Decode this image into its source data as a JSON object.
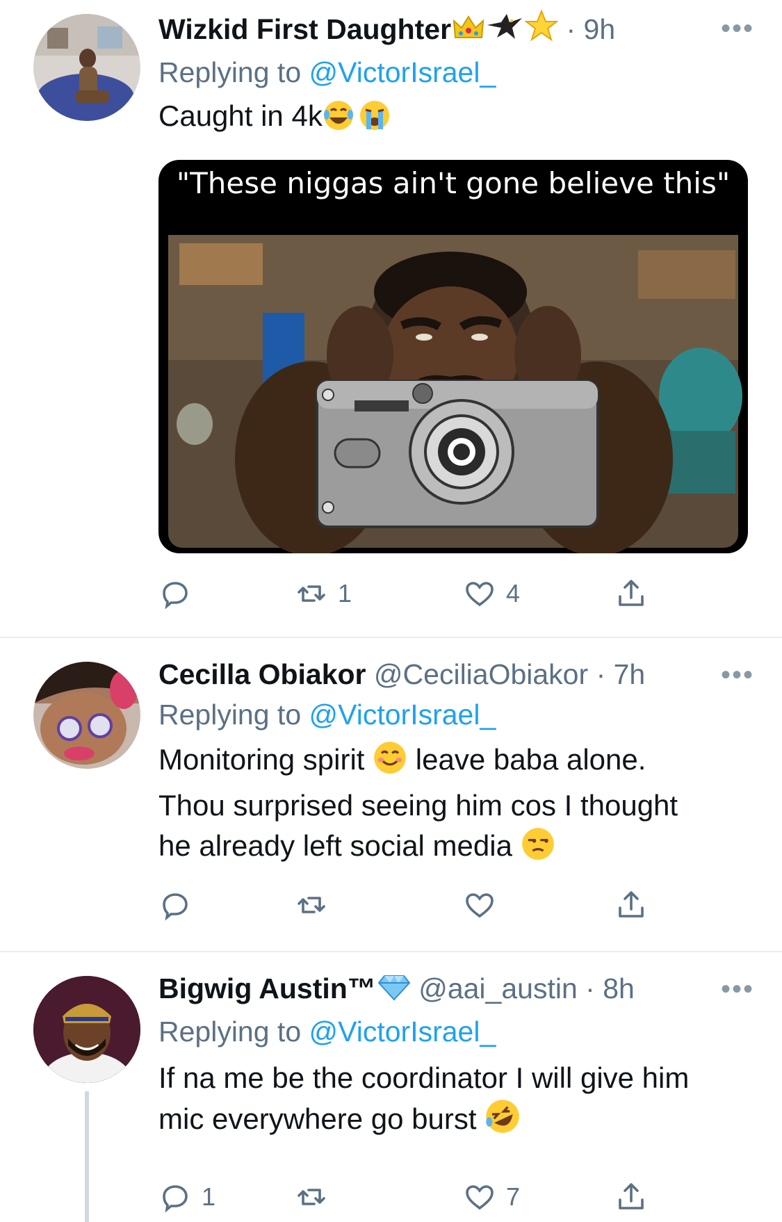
{
  "tweets": [
    {
      "name": "Wizkid First Daughter",
      "handle": "",
      "time": "· 9h",
      "badges": [
        "crown-emoji",
        "eagle-emoji",
        "star-emoji"
      ],
      "replying_label": "Replying to",
      "replying_to": "@VictorIsrael_",
      "text": "Caught in 4k",
      "emojis": [
        "laughing-crying-emoji",
        "loudly-crying-emoji"
      ],
      "media_caption": "\"These niggas ain't gone believe this\"",
      "reply_count": "",
      "retweet_count": "1",
      "like_count": "4"
    },
    {
      "name": "Cecilla Obiakor",
      "handle": "@CeciliaObiakor",
      "time": "· 7h",
      "replying_label": "Replying to",
      "replying_to": "@VictorIsrael_",
      "text_line1_a": "Monitoring spirit",
      "text_line1_b": "leave baba alone.",
      "text_line2": "Thou surprised seeing him cos I thought",
      "text_line3": "he already left social media",
      "emojis": [
        "smiling-face-emoji",
        "unamused-face-emoji"
      ],
      "reply_count": "",
      "retweet_count": "",
      "like_count": ""
    },
    {
      "name": "Bigwig Austin™",
      "handle": "@aai_austin",
      "time": "· 8h",
      "badges": [
        "gem-emoji"
      ],
      "replying_label": "Replying to",
      "replying_to": "@VictorIsrael_",
      "text_line1": "If na me be the coordinator I will give him",
      "text_line2": "mic everywhere go burst",
      "emojis": [
        "rolling-laughing-emoji"
      ],
      "reply_count": "1",
      "retweet_count": "",
      "like_count": "7"
    }
  ],
  "more_label": "•••",
  "colors": {
    "text": "#0f1419",
    "secondary": "#5b7083",
    "link": "#1da1f2",
    "divider": "#e6ecf0"
  }
}
